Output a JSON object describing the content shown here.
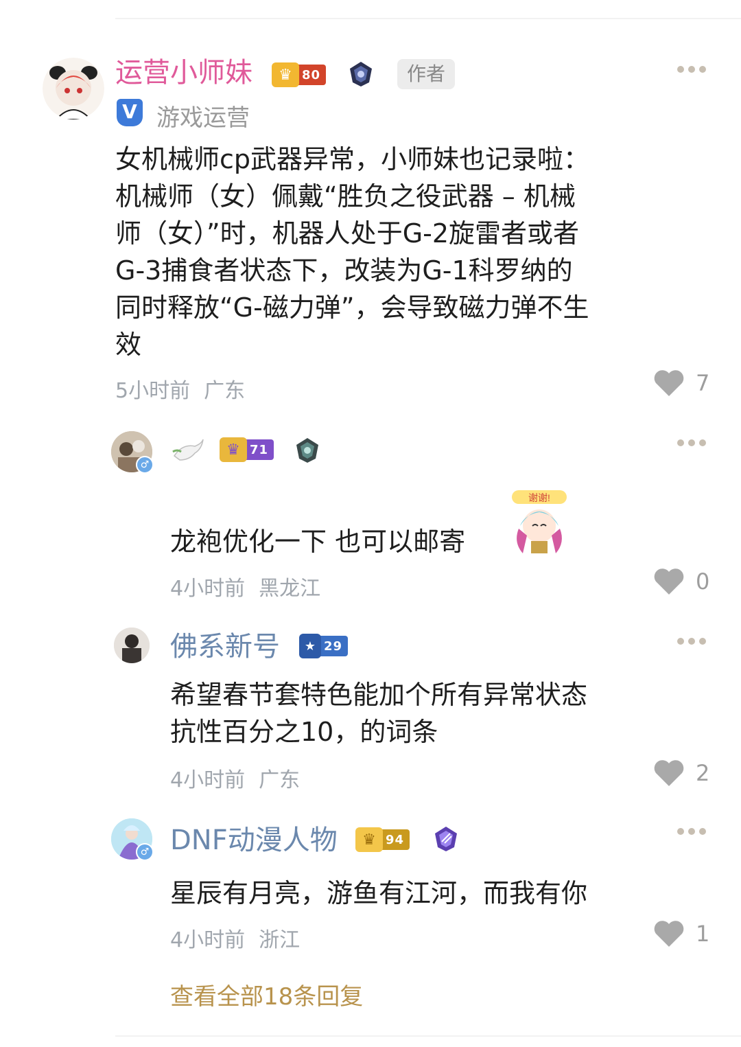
{
  "comment": {
    "author": "运营小师妹",
    "level": "80",
    "author_tag": "作者",
    "verified_label": "游戏运营",
    "text_lines": [
      "女机械师cp武器异常，小师妹也记录啦：",
      "机械师（女）佩戴“胜负之役武器 – 机械",
      "师（女）”时，机器人处于G-2旋雷者或者",
      "G-3捕食者状态下，改装为G-1科罗纳的",
      "同时释放“G-磁力弹”，会导致磁力弹不生",
      "效"
    ],
    "time": "5小时前",
    "location": "广东",
    "likes": "7"
  },
  "replies": [
    {
      "level": "71",
      "text": "龙袍优化一下 也可以邮寄",
      "sticker_text": "谢谢!",
      "time": "4小时前",
      "location": "黑龙江",
      "likes": "0"
    },
    {
      "name": "佛系新号",
      "level": "29",
      "text_lines": [
        "希望春节套特色能加个所有异常状态",
        "抗性百分之10，的词条"
      ],
      "time": "4小时前",
      "location": "广东",
      "likes": "2"
    },
    {
      "name": "DNF动漫人物",
      "level": "94",
      "text": "星辰有月亮，游鱼有江河，而我有你",
      "time": "4小时前",
      "location": "浙江",
      "likes": "1"
    }
  ],
  "view_all": "查看全部18条回复",
  "colors": {
    "author_name": "#e05a9a",
    "reply_name": "#6b88ad",
    "view_all": "#b8934d",
    "more_dots": "#c7beb1"
  },
  "icons": {
    "more": "more-dots-icon",
    "like": "heart-icon",
    "verified": "v-badge-icon",
    "male": "male-icon"
  }
}
